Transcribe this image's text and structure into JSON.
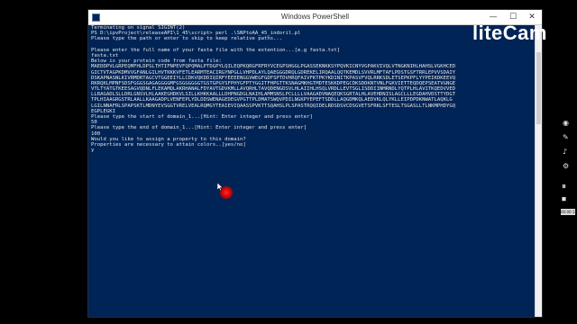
{
  "window": {
    "title": "Windows PowerShell",
    "minimize": "—",
    "maximize": "☐",
    "close": "✕"
  },
  "console": {
    "lines": [
      "Terminating on signal SIGINT(2)",
      "PS D:\\ipvProject\\releaseAPI\\1_45\\script> perl .\\SNPtoAA_45_indoril.pl",
      "Please type the path or enter to skip to keep relative paths...",
      "",
      "Please enter the full name of your fasta file with the extention...[e.g fasta.txt]",
      "fasta.txt",
      "Below is your protein code from fasta file:"
    ],
    "sequence": [
      "MAEDDPVLGRPEQMFHLDPSLTHTIFNPEVFQPQMALPTDGPYLQILEQPKQRGFRFRYVCEGPSHGGLPGASSEKNKKSYPQVKICNYVGPAKVIVQLVTNGKNIHLHAHSLVGKHCED",
      "GICTVTAGPKDMVVGFANLGILHVTKKKVFETLEARMTEACIRGYNPGLLVHPDLAYLQAEGGGDRQLGDREKELIRQAALQQTKEMDLSVVRLMFTAFLPDSTGSFTRRLEPVVSDAIY",
      "DSKAPNASNLKIVRMDRTAGCVTGGEEIYLLCDKVQKDDIQIRFYEEEENGGVWEGFGDFSPTDVHRQFAIVFKTPKYKDINITKPASVFVQLRRKSDLETSEPKPFLYYPEIKDKEEVQ",
      "RKRQKLMPNFSDSFGGGSGAGAGGGGMFGSGGGGGGTGSTGPGYSFPHYGFPTYGGITFHPGTTKSNAGMKHGTMDTESKKDPEGCDKSDDKNTVNLFGKVIETTEQDQEPSEATVGNGE",
      "VTLTYATGTKEESAGVQDNLFLEKAMQLAKRHANALFDYAVTGDVKMLLAVQRHLTAVQDENGDSVLHLAIIHLHSQLVRDLLEVTSGLISDDIINMRNDLYQTPLHLAVITKQEDVVED",
      "LLRAGADLSLLDRLGNSVLHLAAKEGHDKVLSILLKHKKAALLLDHPNGDGLNAIHLAMMSNSLPCLLLLVAAGADVNAQEQKSGRTALHLAVEHDNISLAGCLLLEGDAHVDSTTYDGT",
      "TPLHIAAGRGSTRLAALLKAAGADPLVENFEPLYDLDDSWENAGEDEGVPGTTPLDMATSWQVPDILNGKPYEPEFTSDDLLAQGDMKQLAEDVKLQLYKLLEIPDPDKNWATLAQKLG",
      "LGILNNAFRLSPAPSKTLMDNYEVSGGTVRELVEALRQMGYTEAIEVIQAASSPVKTTSQAHSLPLSPASTRQQIDELRDSDSVCDSGVETSFRKLSFTESLTSGASLLTLNKMPHDYGQ",
      "EGPLEGKI"
    ],
    "after": [
      "Please type the start of domain_1...[Hint: Enter integer and press enter]",
      "50",
      "Please type the end of domain_1...[Hint: Enter integer and press enter]",
      "100",
      "Would you like to assign a property to this domain?",
      "Properties are necessary to attain colors..[yes/no]",
      "y"
    ]
  },
  "overlay": {
    "watermark": "liteCam",
    "rec_label": "00:00:12"
  },
  "colors": {
    "console_bg": "#012456",
    "console_text": "#e6e6e6",
    "cursor_highlight": "#d40000"
  }
}
